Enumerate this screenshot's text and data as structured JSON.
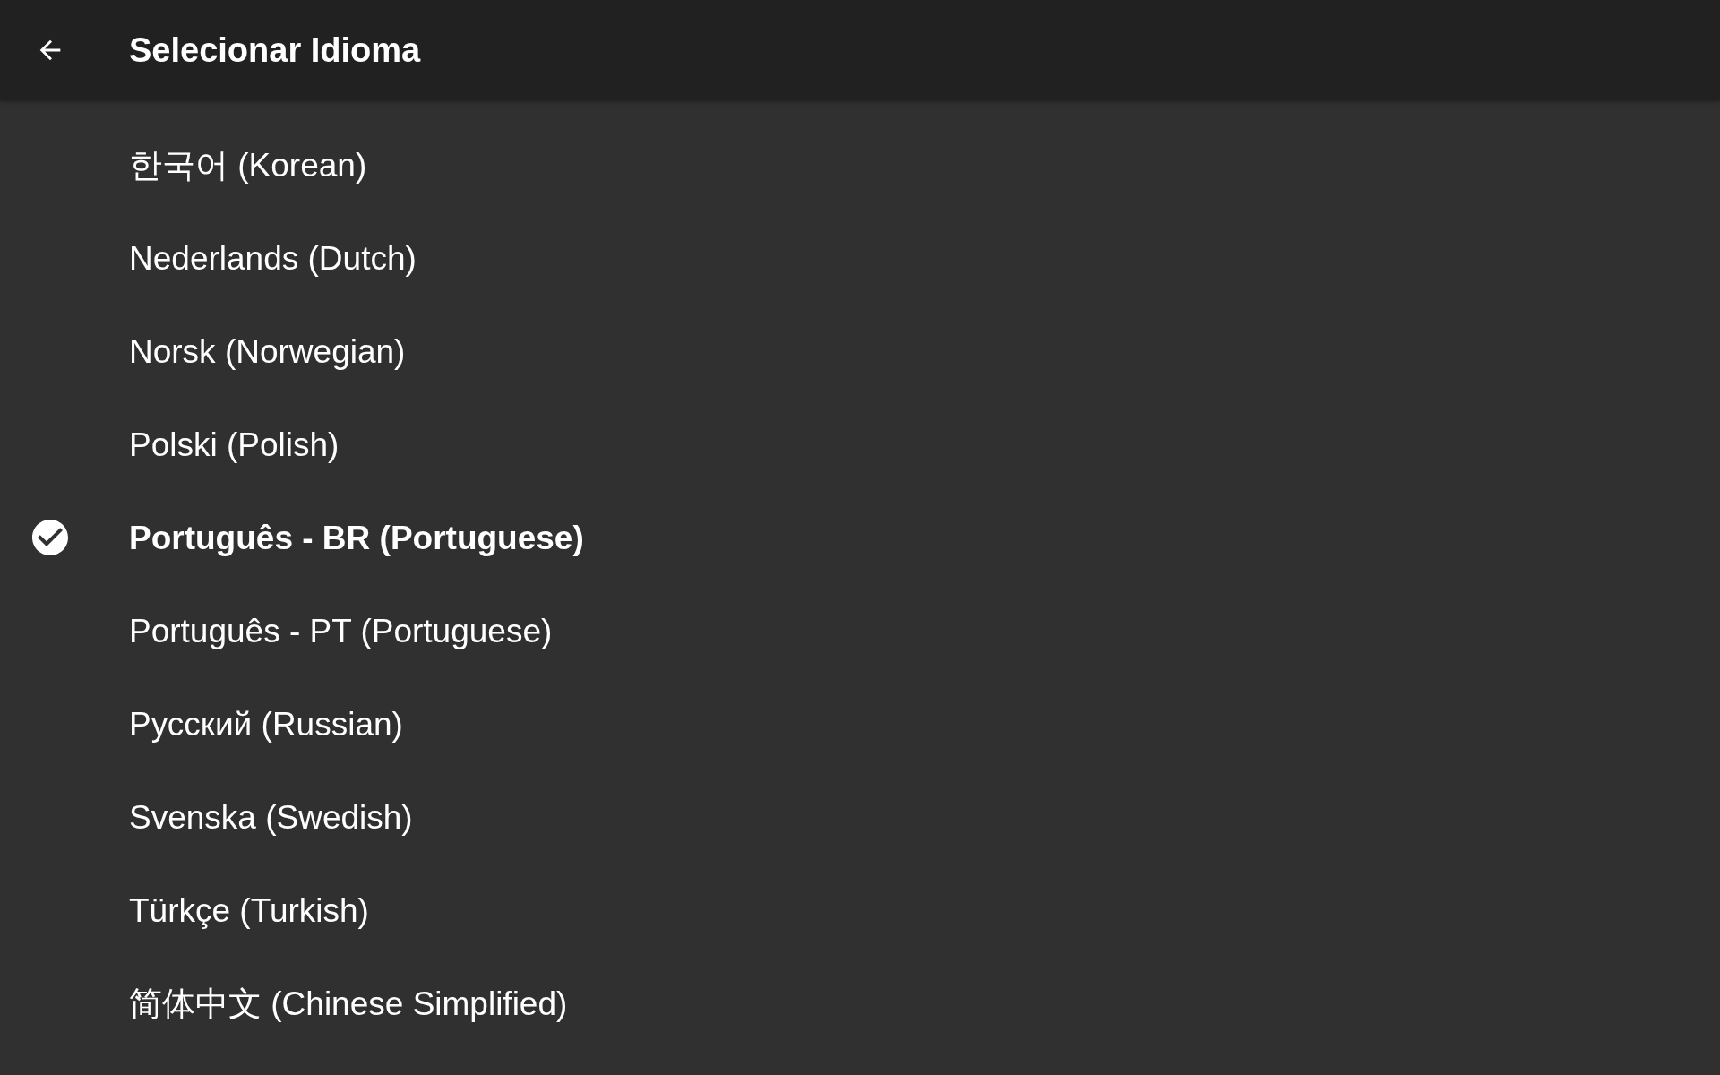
{
  "app_bar": {
    "title": "Selecionar Idioma"
  },
  "languages": [
    {
      "label": "한국어 (Korean)",
      "selected": false
    },
    {
      "label": "Nederlands (Dutch)",
      "selected": false
    },
    {
      "label": "Norsk (Norwegian)",
      "selected": false
    },
    {
      "label": "Polski (Polish)",
      "selected": false
    },
    {
      "label": "Português - BR (Portuguese)",
      "selected": true
    },
    {
      "label": "Português - PT (Portuguese)",
      "selected": false
    },
    {
      "label": "Русский (Russian)",
      "selected": false
    },
    {
      "label": "Svenska (Swedish)",
      "selected": false
    },
    {
      "label": "Türkçe (Turkish)",
      "selected": false
    },
    {
      "label": "简体中文 (Chinese Simplified)",
      "selected": false
    }
  ]
}
